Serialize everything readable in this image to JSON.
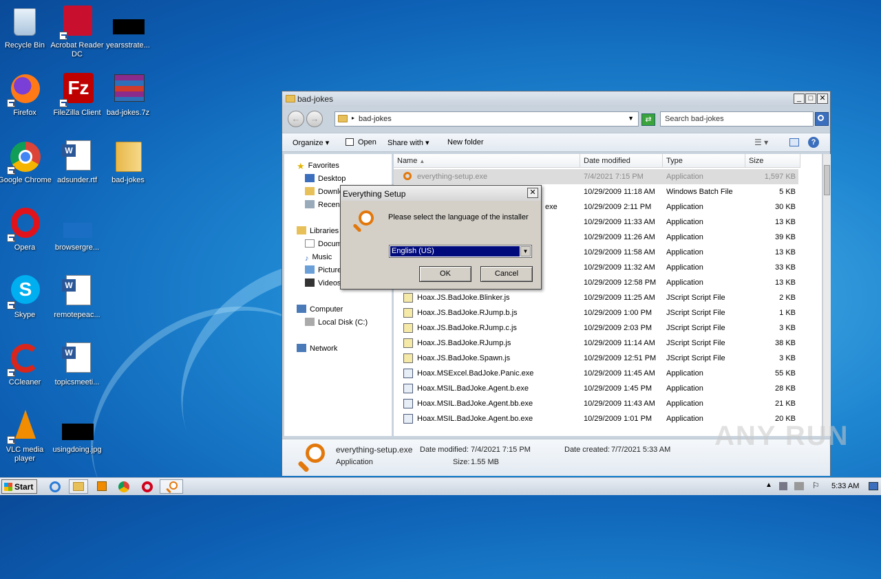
{
  "desktop": {
    "icons": [
      {
        "label": "Recycle Bin"
      },
      {
        "label": "Acrobat Reader DC"
      },
      {
        "label": "yearsstrate..."
      },
      {
        "label": "Firefox"
      },
      {
        "label": "FileZilla Client"
      },
      {
        "label": "bad-jokes.7z"
      },
      {
        "label": "Google Chrome"
      },
      {
        "label": "adsunder.rtf"
      },
      {
        "label": "bad-jokes"
      },
      {
        "label": "Opera"
      },
      {
        "label": "browsergre..."
      },
      {
        "label": "Skype"
      },
      {
        "label": "remotepeac..."
      },
      {
        "label": "CCleaner"
      },
      {
        "label": "topicsmeeti..."
      },
      {
        "label": "VLC media player"
      },
      {
        "label": "usingdoing.jpg"
      }
    ]
  },
  "explorer": {
    "title": "bad-jokes",
    "address": "bad-jokes",
    "search_placeholder": "Search bad-jokes",
    "toolbar": {
      "organize": "Organize",
      "open": "Open",
      "share_with": "Share with",
      "new_folder": "New folder"
    },
    "nav": {
      "favorites": "Favorites",
      "desktop": "Desktop",
      "downloads": "Downlo",
      "recent": "Recen",
      "libraries": "Libraries",
      "documents": "Docum",
      "music": "Music",
      "pictures": "Picture",
      "videos": "Videos",
      "computer": "Computer",
      "local_disk": "Local Disk (C:)",
      "network": "Network"
    },
    "columns": {
      "name": "Name",
      "date": "Date modified",
      "type": "Type",
      "size": "Size"
    },
    "files": [
      {
        "name": "everything-setup.exe",
        "date": "7/4/2021 7:15 PM",
        "type": "Application",
        "size": "1,597 KB"
      },
      {
        "name": "",
        "date": "10/29/2009 11:18 AM",
        "type": "Windows Batch File",
        "size": "5 KB"
      },
      {
        "name": "exe",
        "date": "10/29/2009 2:11 PM",
        "type": "Application",
        "size": "30 KB"
      },
      {
        "name": "",
        "date": "10/29/2009 11:33 AM",
        "type": "Application",
        "size": "13 KB"
      },
      {
        "name": "",
        "date": "10/29/2009 11:26 AM",
        "type": "Application",
        "size": "39 KB"
      },
      {
        "name": "",
        "date": "10/29/2009 11:58 AM",
        "type": "Application",
        "size": "13 KB"
      },
      {
        "name": "",
        "date": "10/29/2009 11:32 AM",
        "type": "Application",
        "size": "33 KB"
      },
      {
        "name": "",
        "date": "10/29/2009 12:58 PM",
        "type": "Application",
        "size": "13 KB"
      },
      {
        "name": "Hoax.JS.BadJoke.Blinker.js",
        "date": "10/29/2009 11:25 AM",
        "type": "JScript Script File",
        "size": "2 KB"
      },
      {
        "name": "Hoax.JS.BadJoke.RJump.b.js",
        "date": "10/29/2009 1:00 PM",
        "type": "JScript Script File",
        "size": "1 KB"
      },
      {
        "name": "Hoax.JS.BadJoke.RJump.c.js",
        "date": "10/29/2009 2:03 PM",
        "type": "JScript Script File",
        "size": "3 KB"
      },
      {
        "name": "Hoax.JS.BadJoke.RJump.js",
        "date": "10/29/2009 11:14 AM",
        "type": "JScript Script File",
        "size": "38 KB"
      },
      {
        "name": "Hoax.JS.BadJoke.Spawn.js",
        "date": "10/29/2009 12:51 PM",
        "type": "JScript Script File",
        "size": "3 KB"
      },
      {
        "name": "Hoax.MSExcel.BadJoke.Panic.exe",
        "date": "10/29/2009 11:45 AM",
        "type": "Application",
        "size": "55 KB"
      },
      {
        "name": "Hoax.MSIL.BadJoke.Agent.b.exe",
        "date": "10/29/2009 1:45 PM",
        "type": "Application",
        "size": "28 KB"
      },
      {
        "name": "Hoax.MSIL.BadJoke.Agent.bb.exe",
        "date": "10/29/2009 11:43 AM",
        "type": "Application",
        "size": "21 KB"
      },
      {
        "name": "Hoax.MSIL.BadJoke.Agent.bo.exe",
        "date": "10/29/2009 1:01 PM",
        "type": "Application",
        "size": "20 KB"
      }
    ],
    "details": {
      "name": "everything-setup.exe",
      "kind": "Application",
      "modified_label": "Date modified:",
      "modified": "7/4/2021 7:15 PM",
      "size_label": "Size:",
      "size": "1.55 MB",
      "created_label": "Date created:",
      "created": "7/7/2021 5:33 AM"
    }
  },
  "dialog": {
    "title": "Everything Setup",
    "message": "Please select the language of the installer",
    "language": "English (US)",
    "ok": "OK",
    "cancel": "Cancel",
    "close": "✕"
  },
  "taskbar": {
    "start": "Start",
    "clock": "5:33 AM"
  },
  "watermark": "ANY RUN",
  "colors": {
    "accent_orange": "#e2780c",
    "selection_blue": "#000a7a"
  }
}
